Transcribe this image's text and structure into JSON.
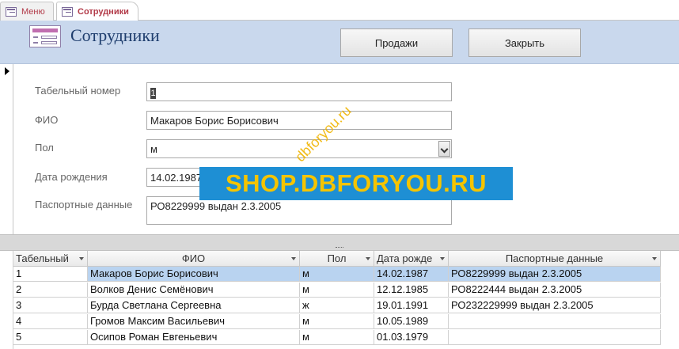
{
  "tabs": [
    {
      "label": "Меню",
      "active": false
    },
    {
      "label": "Сотрудники",
      "active": true
    }
  ],
  "header": {
    "title": "Сотрудники",
    "sales_button": "Продажи",
    "close_button": "Закрыть"
  },
  "form": {
    "tabnum_label": "Табельный номер",
    "tabnum_value": "1",
    "fio_label": "ФИО",
    "fio_value": "Макаров Борис Борисович",
    "gender_label": "Пол",
    "gender_value": "м",
    "birth_label": "Дата рождения",
    "birth_value": "14.02.1987",
    "passport_label": "Паспортные данные",
    "passport_value": "РО8229999 выдан 2.3.2005"
  },
  "watermark": {
    "banner": "SHOP.DBFORYOU.RU",
    "diagonal": "dbforyou.ru"
  },
  "table": {
    "columns": [
      "Табельный",
      "ФИО",
      "Пол",
      "Дата рожде",
      "Паспортные данные"
    ],
    "rows": [
      [
        "1",
        "Макаров Борис Борисович",
        "м",
        "14.02.1987",
        "РО8229999 выдан 2.3.2005"
      ],
      [
        "2",
        "Волков Денис Семёнович",
        "м",
        "12.12.1985",
        "РО8222444 выдан 2.3.2005"
      ],
      [
        "3",
        "Бурда Светлана Сергеевна",
        "ж",
        "19.01.1991",
        "РО232229999 выдан 2.3.2005"
      ],
      [
        "4",
        "Громов Максим Васильевич",
        "м",
        "10.05.1989",
        ""
      ],
      [
        "5",
        "Осипов Роман Евгеньевич",
        "м",
        "01.03.1979",
        ""
      ]
    ],
    "selected_row": 0
  }
}
